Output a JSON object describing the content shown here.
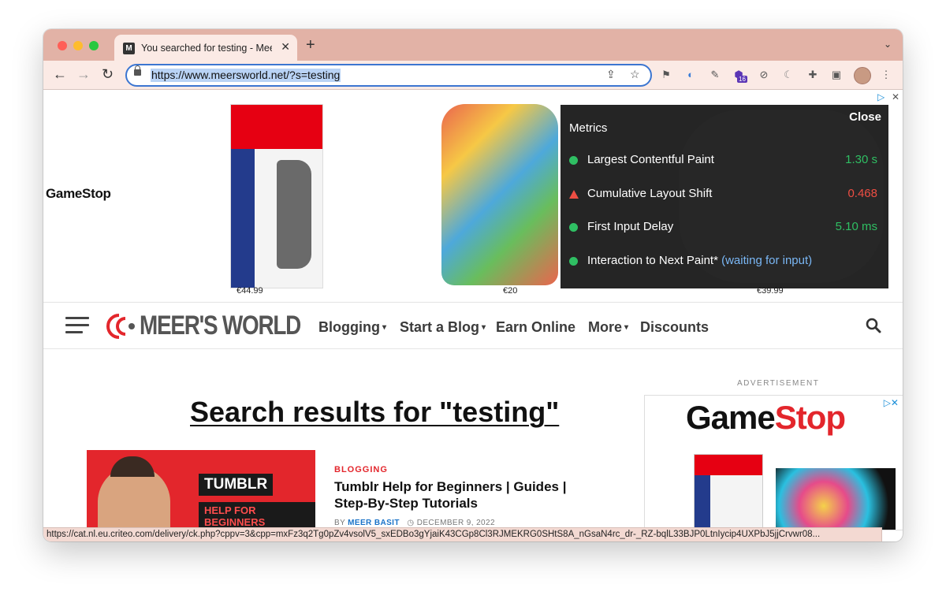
{
  "browser": {
    "tab_title": "You searched for testing - Meer",
    "tab_favicon": "M",
    "url": "https://www.meersworld.net/?s=testing",
    "extension_badge": "16",
    "status_url": "https://cat.nl.eu.criteo.com/delivery/ck.php?cppv=3&cpp=mxFz3q2Tg0pZv4vsolV5_sxEDBo3gYjaiK43CGp8Cl3RJMEKRG0SHtS8A_nGsaN4rc_dr-_RZ-bqlL33BJP0LtnIycip4UXPbJ5jjCrvwr08..."
  },
  "top_ad": {
    "brand": "GameStop",
    "prices": [
      "€44.99",
      "€20",
      "€39.99"
    ]
  },
  "metrics": {
    "title": "Metrics",
    "close": "Close",
    "rows": [
      {
        "label": "Largest Contentful Paint",
        "value": "1.30 s",
        "status": "good",
        "color": "#2fbf63"
      },
      {
        "label": "Cumulative Layout Shift",
        "value": "0.468",
        "status": "poor",
        "color": "#ee4e43"
      },
      {
        "label": "First Input Delay",
        "value": "5.10 ms",
        "status": "good",
        "color": "#2fbf63"
      },
      {
        "label": "Interaction to Next Paint*",
        "value": "(waiting for input)",
        "status": "good",
        "color": "#7ab7f5"
      }
    ]
  },
  "site": {
    "logo": "MEER'S WORLD",
    "menu": [
      "Blogging",
      "Start a Blog",
      "Earn Online",
      "More",
      "Discounts"
    ],
    "accent": "#e3262c"
  },
  "content": {
    "page_title": "Search results for \"testing\"",
    "post": {
      "category": "BLOGGING",
      "title": "Tumblr Help for Beginners | Guides | Step-By-Step Tutorials",
      "by": "BY",
      "author": "MEER BASIT",
      "date": "DECEMBER 9, 2022",
      "thumb_tag1": "TUMBLR",
      "thumb_tag2": "HELP FOR BEGINNERS"
    },
    "ad_label": "ADVERTISEMENT",
    "side_ad_brand_a": "Game",
    "side_ad_brand_b": "Stop"
  }
}
